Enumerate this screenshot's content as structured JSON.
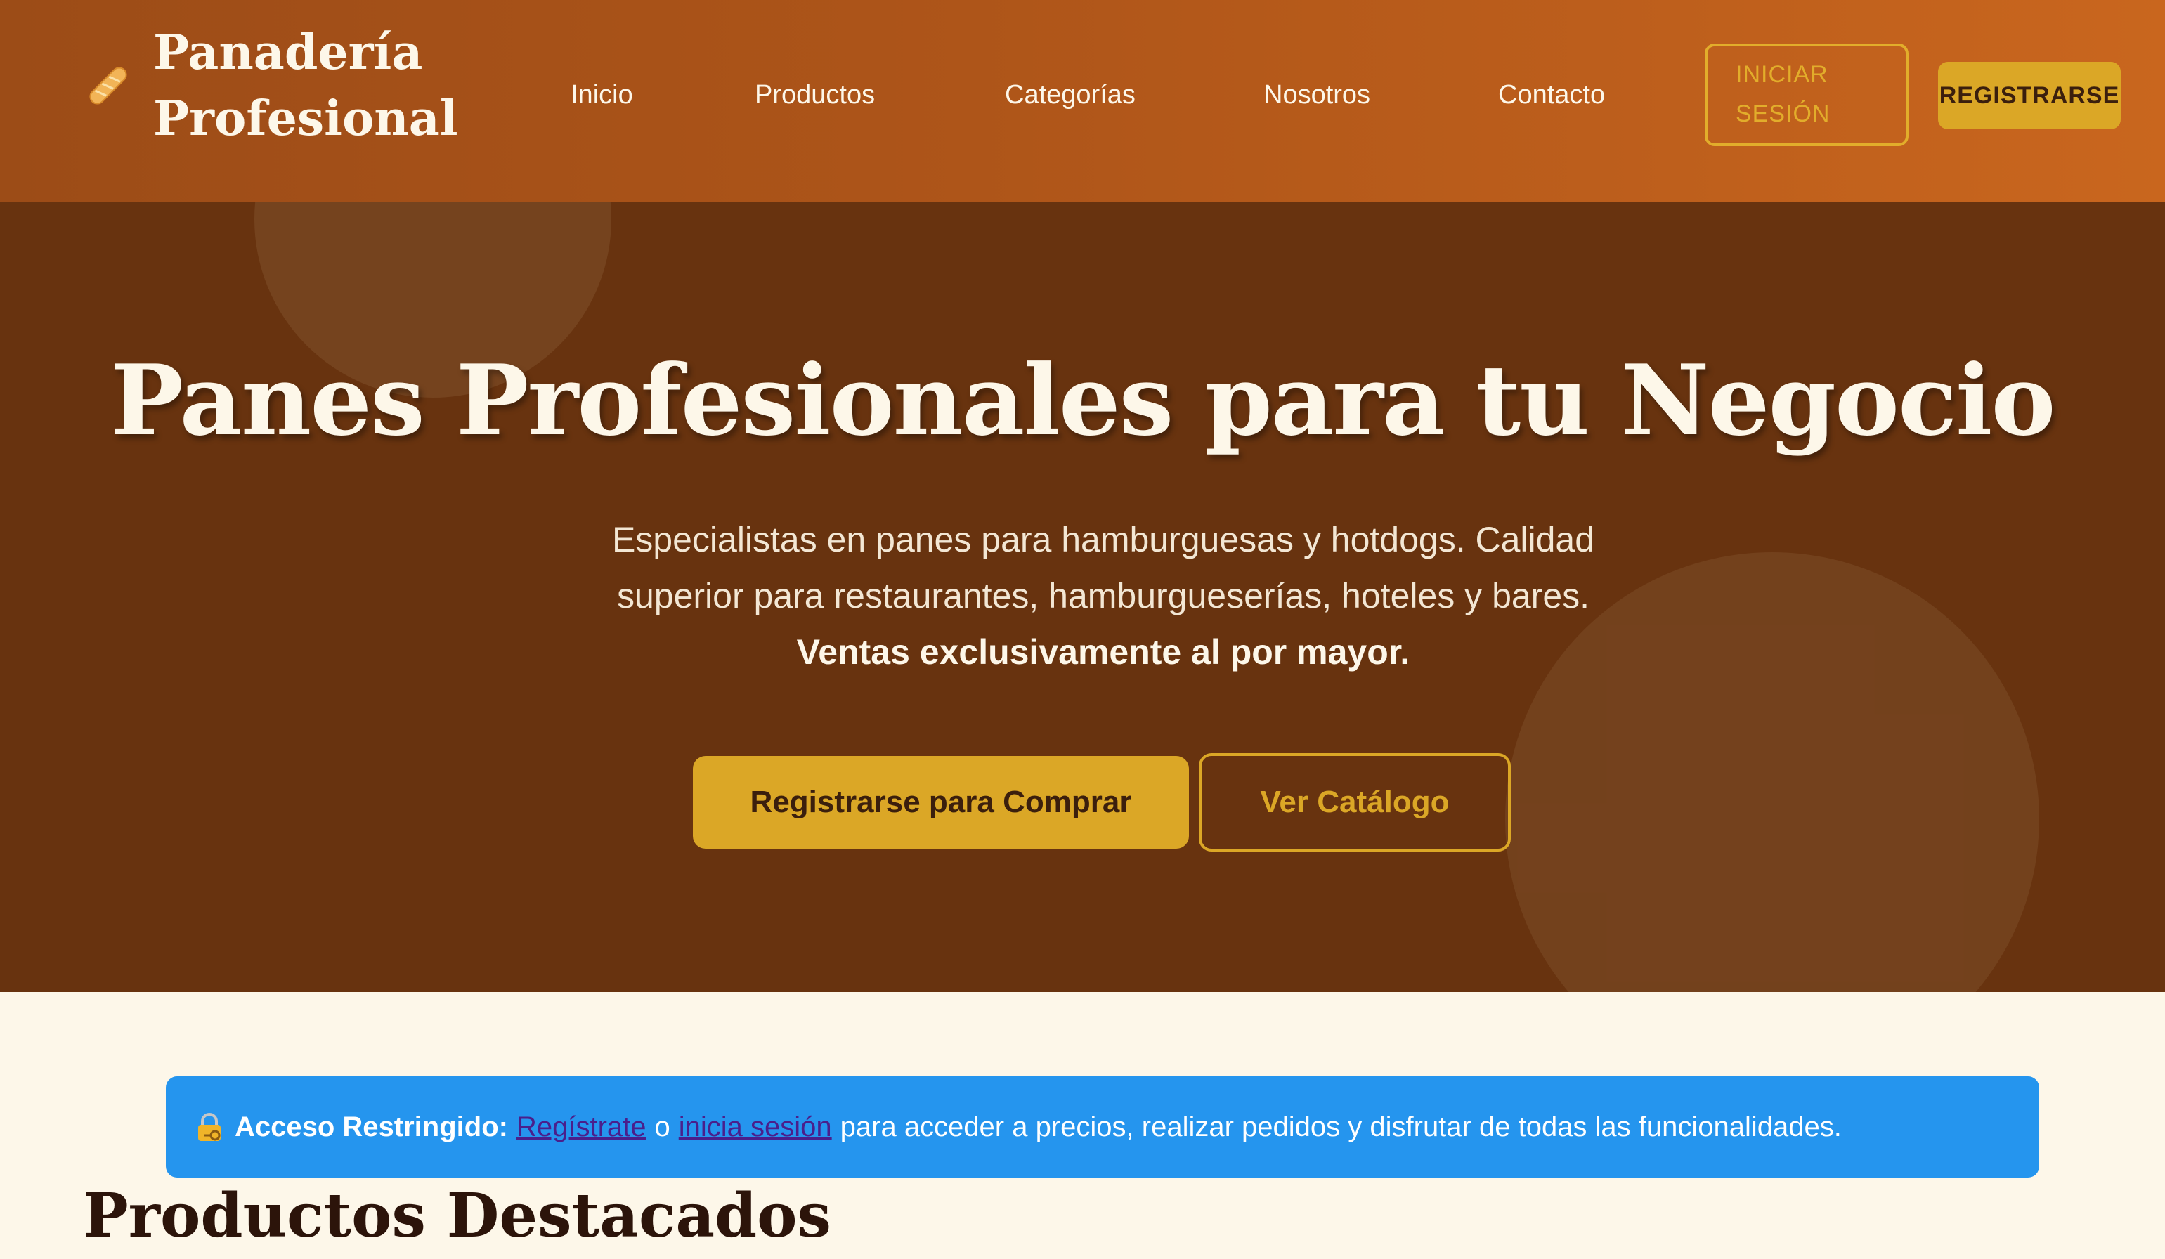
{
  "header": {
    "logo_line1": "Panadería",
    "logo_line2": "Profesional",
    "logo_icon": "baguette-icon",
    "nav": [
      "Inicio",
      "Productos",
      "Categorías",
      "Nosotros",
      "Contacto"
    ],
    "login_line1": "INICIAR",
    "login_line2": "SESIÓN",
    "register": "REGISTRARSE"
  },
  "hero": {
    "title": "Panes Profesionales para tu Negocio",
    "subtitle": "Especialistas en panes para hamburguesas y hotdogs. Calidad superior para restaurantes, hamburgueserías, hoteles y bares.",
    "subtitle_bold": "Ventas exclusivamente al por mayor.",
    "primary_button": "Registrarse para Comprar",
    "secondary_button": "Ver Catálogo"
  },
  "alert": {
    "icon": "lock-key-icon",
    "label": "Acceso Restringido:",
    "link_register": "Regístrate",
    "connector": "o",
    "link_login": "inicia sesión",
    "message": "para acceder a precios, realizar pedidos y disfrutar de todas las funcionalidades."
  },
  "featured": {
    "title": "Productos Destacados"
  },
  "colors": {
    "header_start": "#9c4c17",
    "header_end": "#c9661e",
    "hero_bg": "#68330f",
    "accent": "#dba726",
    "alert_bg": "#2595ee",
    "page_bg": "#fdf7e9"
  }
}
